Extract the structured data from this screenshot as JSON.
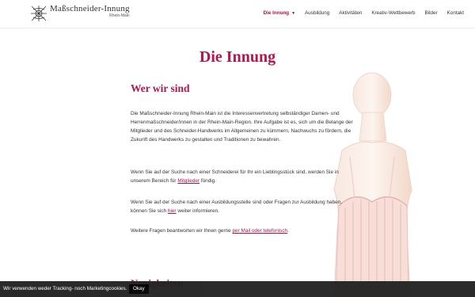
{
  "header": {
    "logo_name": "Maßschneider-Innung",
    "logo_sub": "Rhein-Main",
    "nav": [
      {
        "label": "Die Innung"
      },
      {
        "label": "Ausbildung"
      },
      {
        "label": "Aktivitäten"
      },
      {
        "label": "Kreativ-Wettbewerb"
      },
      {
        "label": "Bilder"
      },
      {
        "label": "Kontakt"
      }
    ]
  },
  "main": {
    "title": "Die Innung",
    "section_title": "Wer wir sind",
    "p1": "Die Maßschneider-Innung Rhein-Main ist die Interessenvertretung selbständiger Damen- und Herrenmaßschneider/innen in der Rhein-Main-Region. Ihre Aufgabe ist es, sich um die Belange der Mitglieder und des Schneider-Handwerks im Allgemeinen zu kümmern, Nachwuchs zu fördern, die Zukunft des Handwerks zu gestalten und Traditionen zu bewahren.",
    "p2_before": "Wenn Sie auf der Suche nach einer Schneiderei für Ihr ein Lieblingsstück sind, werden Sie in unserem Bereich für ",
    "p2_link": "Mitglieder",
    "p2_after": " fündig.",
    "p3_before": "Wenn Sie auf der Suche nach einer Ausbildungsstelle sind oder Fragen zur Ausbildung haben, können Sie sich ",
    "p3_link": "hier",
    "p3_after": " weiter informieren.",
    "p4_before": "Weitere Fragen beantworten wir Ihnen gerne ",
    "p4_link": "per Mail oder telefonisch",
    "p4_after": ".",
    "next_title": "Neuigkeiten"
  },
  "cookie": {
    "text": "Wir verwenden weder Tracking- noch Marketingcookies.",
    "button": "Okay"
  },
  "colors": {
    "accent": "#b51550",
    "cookie_bg": "#222222"
  },
  "icons": {
    "logo": "needle-thread-logo-icon",
    "dropdown": "chevron-down-icon"
  }
}
